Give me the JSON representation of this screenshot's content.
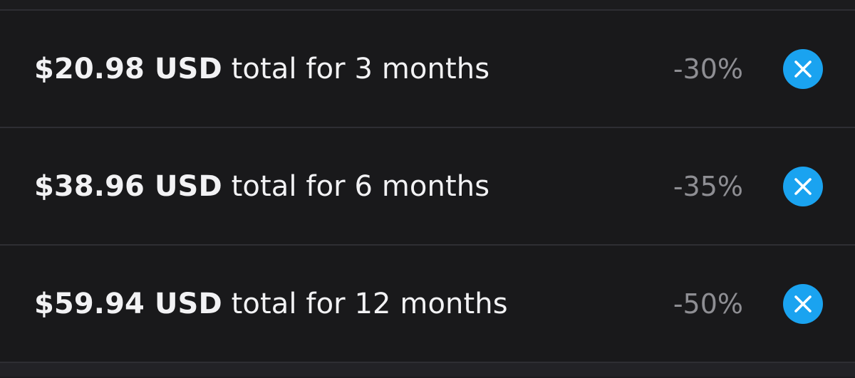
{
  "subscription_options": [
    {
      "price": "$20.98 USD",
      "description": "total for 3 months",
      "discount": "-30%",
      "action_icon": "close-icon"
    },
    {
      "price": "$38.96 USD",
      "description": "total for 6 months",
      "discount": "-35%",
      "action_icon": "close-icon"
    },
    {
      "price": "$59.94 USD",
      "description": "total for 12 months",
      "discount": "-50%",
      "action_icon": "close-icon"
    }
  ],
  "colors": {
    "background": "#19191b",
    "divider": "#2e2e33",
    "primary_text": "#f2f2f4",
    "secondary_text": "#8e8e93",
    "accent": "#1aa3f0"
  }
}
